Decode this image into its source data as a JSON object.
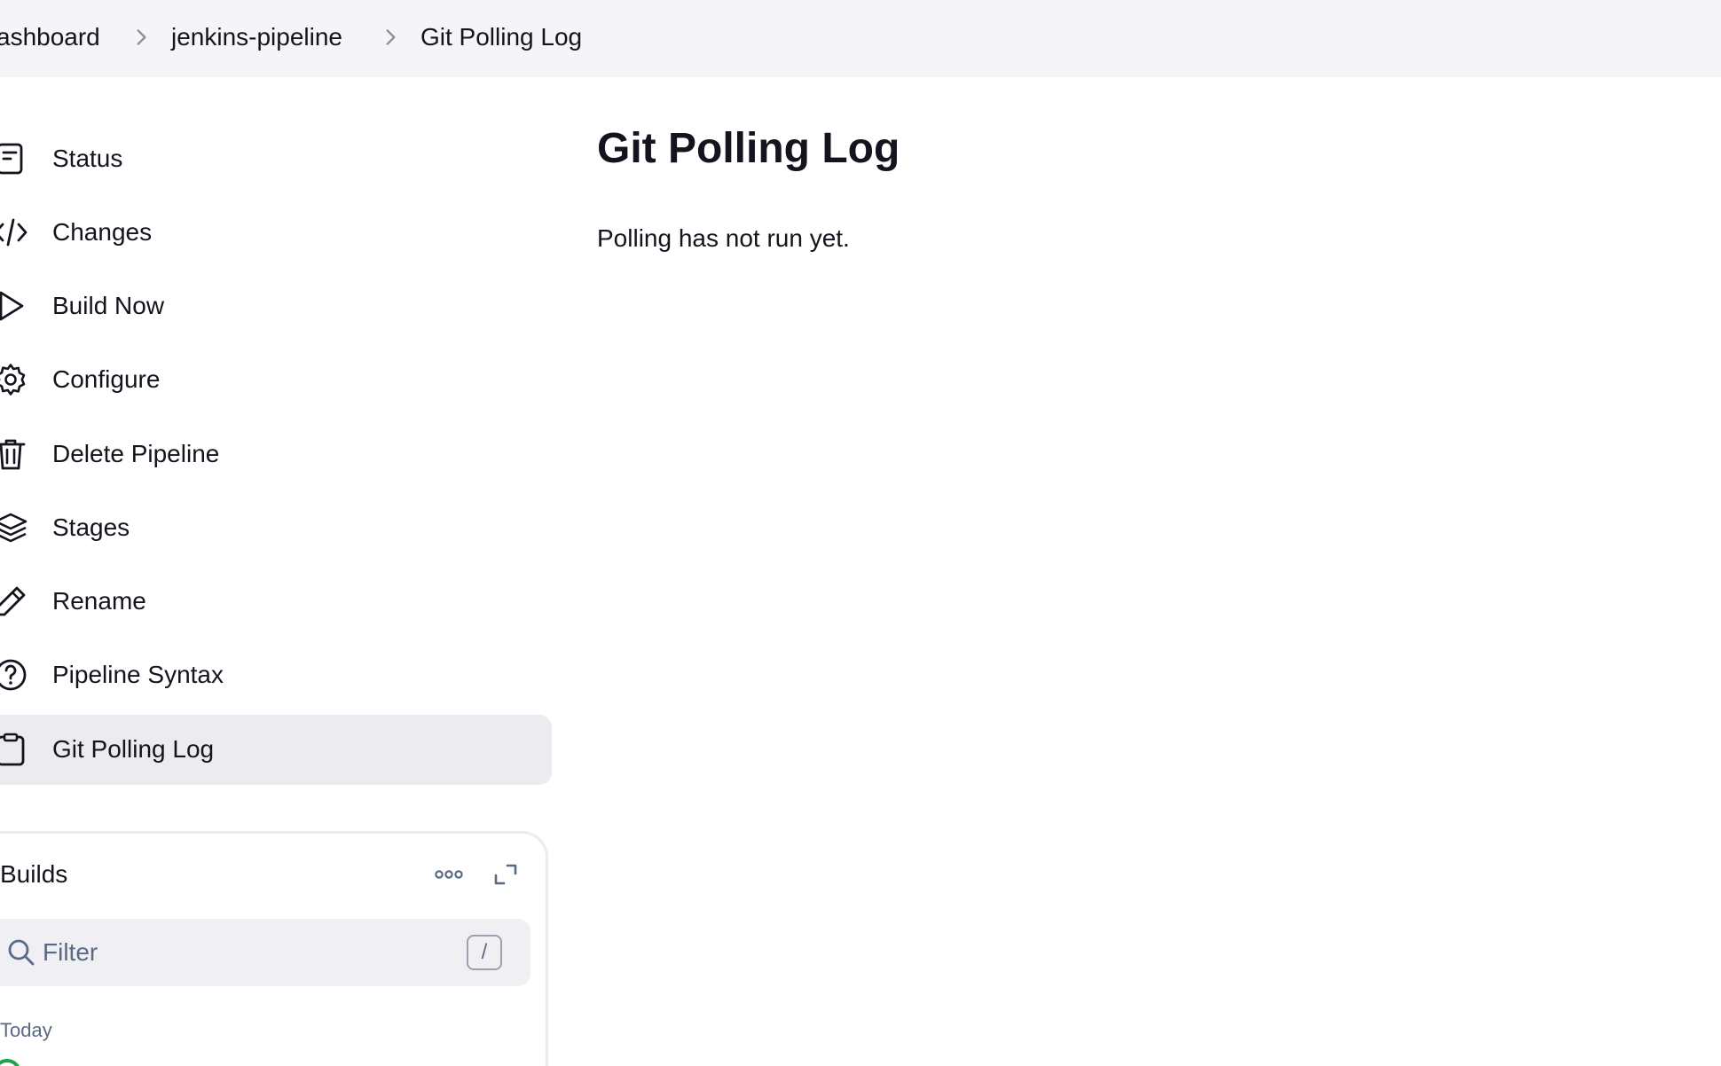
{
  "breadcrumb": {
    "items": [
      {
        "label": "ashboard"
      },
      {
        "label": "jenkins-pipeline"
      },
      {
        "label": "Git Polling Log"
      }
    ]
  },
  "sidebar": {
    "items": [
      {
        "label": "Status",
        "icon": "document-icon"
      },
      {
        "label": "Changes",
        "icon": "code-icon"
      },
      {
        "label": "Build Now",
        "icon": "play-icon"
      },
      {
        "label": "Configure",
        "icon": "gear-icon"
      },
      {
        "label": "Delete Pipeline",
        "icon": "trash-icon"
      },
      {
        "label": "Stages",
        "icon": "layers-icon"
      },
      {
        "label": "Rename",
        "icon": "pencil-icon"
      },
      {
        "label": "Pipeline Syntax",
        "icon": "help-circle-icon"
      },
      {
        "label": "Git Polling Log",
        "icon": "clipboard-icon",
        "active": true
      }
    ]
  },
  "builds": {
    "title": "Builds",
    "filter_placeholder": "Filter",
    "filter_shortcut": "/",
    "group_label": "Today"
  },
  "main": {
    "title": "Git Polling Log",
    "message": "Polling has not run yet."
  },
  "colors": {
    "header_bg": "#f5f5f7",
    "active_item_bg": "#ebebf0",
    "muted_text": "#5a6a85",
    "success": "#1ea446"
  }
}
